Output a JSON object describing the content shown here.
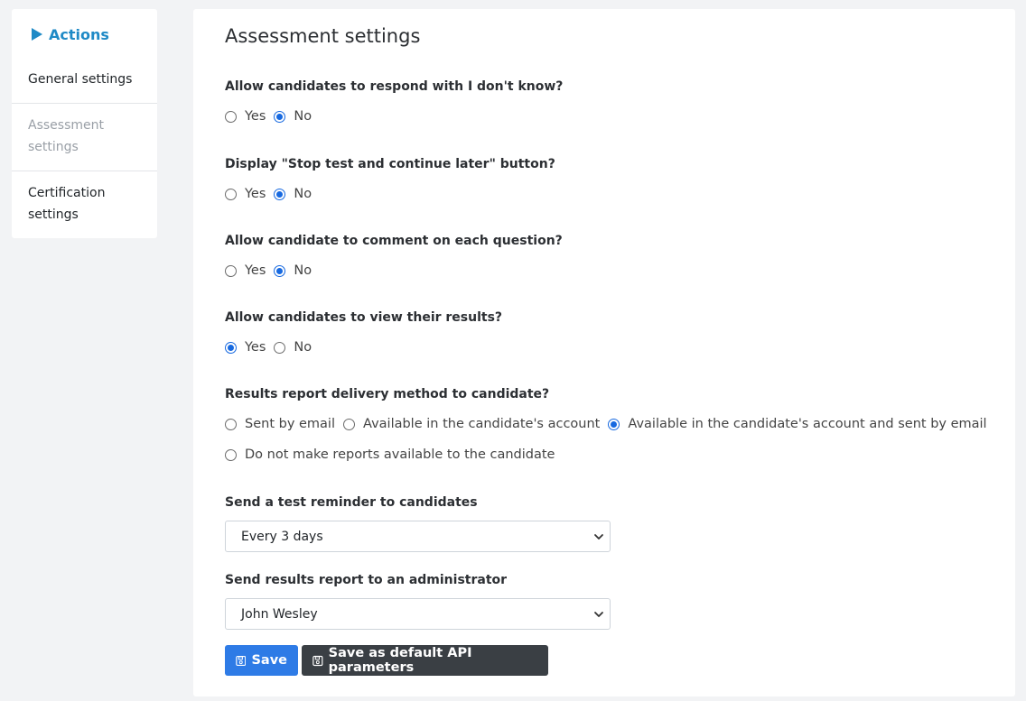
{
  "sidebar": {
    "header": "Actions",
    "items": [
      {
        "label": "General settings"
      },
      {
        "label": "Assessment settings"
      },
      {
        "label": "Certification settings"
      }
    ]
  },
  "main": {
    "title": "Assessment settings",
    "questions": [
      {
        "label": "Allow candidates to respond with I don't know?",
        "options": [
          "Yes",
          "No"
        ],
        "selected": "No"
      },
      {
        "label": "Display \"Stop test and continue later\" button?",
        "options": [
          "Yes",
          "No"
        ],
        "selected": "No"
      },
      {
        "label": "Allow candidate to comment on each question?",
        "options": [
          "Yes",
          "No"
        ],
        "selected": "No"
      },
      {
        "label": "Allow candidates to view their results?",
        "options": [
          "Yes",
          "No"
        ],
        "selected": "Yes"
      }
    ],
    "delivery": {
      "label": "Results report delivery method to candidate?",
      "options": [
        "Sent by email",
        "Available in the candidate's account",
        "Available in the candidate's account and sent by email",
        "Do not make reports available to the candidate"
      ],
      "selected": "Available in the candidate's account and sent by email"
    },
    "reminder": {
      "label": "Send a test reminder to candidates",
      "value": "Every 3 days"
    },
    "admin_report": {
      "label": "Send results report to an administrator",
      "value": "John Wesley"
    },
    "buttons": {
      "save": "Save",
      "save_api": "Save as default API parameters"
    }
  },
  "colors": {
    "accent": "#1f8ac6",
    "primary": "#2e7be6",
    "dark": "#3a3f44",
    "radio": "#1769e0"
  }
}
